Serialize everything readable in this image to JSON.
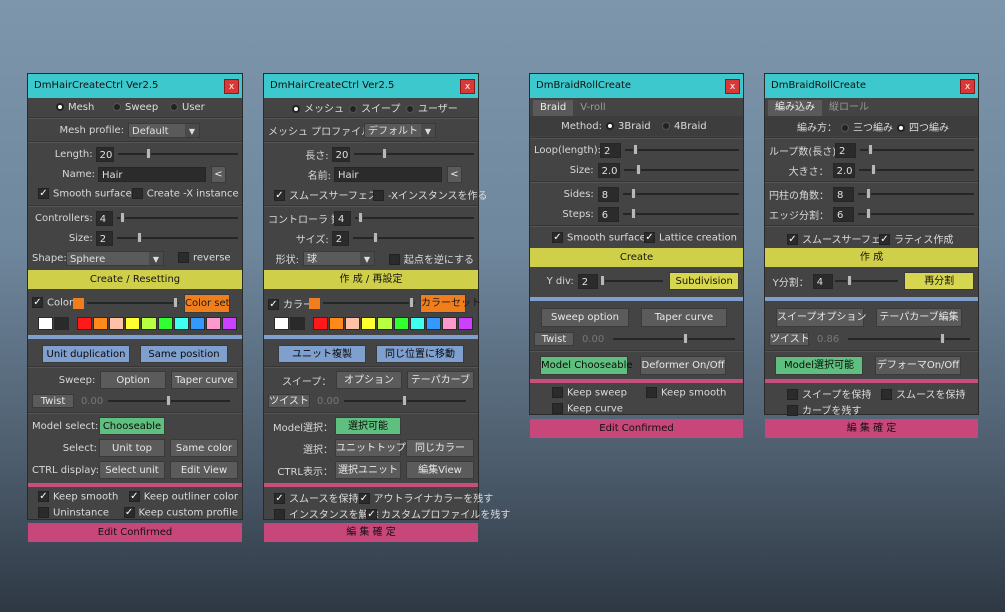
{
  "w1": {
    "title": "DmHairCreateCtrl Ver2.5",
    "close": "x",
    "modes": [
      "Mesh",
      "Sweep",
      "User"
    ],
    "profile_label": "Mesh profile:",
    "profile_value": "Default",
    "length_label": "Length:",
    "length_value": "20",
    "name_label": "Name:",
    "name_value": "Hair",
    "name_btn": "<",
    "smooth_surface": "Smooth surface",
    "create_x": "Create -X instance",
    "controllers_label": "Controllers:",
    "controllers_value": "4",
    "size_label": "Size:",
    "size_value": "2",
    "shape_label": "Shape:",
    "shape_value": "Sphere",
    "reverse": "reverse",
    "create_btn": "Create / Resetting",
    "color_label": "Color",
    "color_set": "Color set",
    "unit_dup": "Unit duplication",
    "same_pos": "Same position",
    "sweep_label": "Sweep:",
    "option_btn": "Option",
    "taper_btn": "Taper curve",
    "twist_label": "Twist",
    "twist_value": "0.00",
    "model_select_label": "Model select:",
    "chooseable": "Chooseable",
    "select_label": "Select:",
    "unit_top": "Unit top",
    "same_color": "Same color",
    "ctrl_label": "CTRL display:",
    "select_unit": "Select unit",
    "edit_view": "Edit View",
    "keep_smooth": "Keep smooth",
    "keep_outliner": "Keep outliner color",
    "uninstance": "Uninstance",
    "keep_custom": "Keep custom profile",
    "edit_confirmed": "Edit Confirmed"
  },
  "w2": {
    "title": "DmHairCreateCtrl Ver2.5",
    "close": "x",
    "modes": [
      "メッシュ",
      "スイープ",
      "ユーザー"
    ],
    "profile_label": "メッシュ プロファイル：",
    "profile_value": "デフォルト",
    "length_label": "長さ:",
    "length_value": "20",
    "name_label": "名前:",
    "name_value": "Hair",
    "name_btn": "<",
    "smooth_surface": "スムースサーフェス",
    "create_x": "-Xインスタンスを作る",
    "controllers_label": "コントローラ 数:",
    "controllers_value": "4",
    "size_label": "サイズ:",
    "size_value": "2",
    "shape_label": "形状:",
    "shape_value": "球",
    "reverse": "起点を逆にする",
    "create_btn": "作 成 / 再設定",
    "color_label": "カラー",
    "color_set": "カラーセット",
    "unit_dup": "ユニット複製",
    "same_pos": "同じ位置に移動",
    "sweep_label": "スイープ：",
    "option_btn": "オプション",
    "taper_btn": "テーパカーブ",
    "twist_label": "ツイスト",
    "twist_value": "0.00",
    "model_select_label": "Model選択：",
    "chooseable": "選択可能",
    "select_label": "選択：",
    "unit_top": "ユニットトップ",
    "same_color": "同じカラー",
    "ctrl_label": "CTRL表示：",
    "select_unit": "選択ユニット",
    "edit_view": "編集View",
    "keep_smooth": "スムースを保持",
    "keep_outliner": "アウトライナカラーを残す",
    "uninstance": "インスタンスを解除",
    "keep_custom": "カスタムプロファイルを残す",
    "edit_confirmed": "編 集 確 定"
  },
  "w3": {
    "title": "DmBraidRollCreate",
    "close": "x",
    "tabs": [
      "Braid",
      "V-roll"
    ],
    "method_label": "Method:",
    "method_opts": [
      "3Braid",
      "4Braid"
    ],
    "loop_label": "Loop(length):",
    "loop_value": "2",
    "size_label": "Size:",
    "size_value": "2.0",
    "sides_label": "Sides:",
    "sides_value": "8",
    "steps_label": "Steps:",
    "steps_value": "6",
    "smooth_surface": "Smooth surface",
    "lattice": "Lattice creation",
    "create_btn": "Create",
    "ydiv_label": "Y div:",
    "ydiv_value": "2",
    "subdiv_btn": "Subdivision",
    "sweep_opt": "Sweep option",
    "taper_btn": "Taper curve",
    "twist_label": "Twist",
    "twist_value": "0.00",
    "model_choose": "Model Chooseable",
    "deformer": "Deformer On/Off",
    "keep_sweep": "Keep sweep",
    "keep_smooth": "Keep smooth",
    "keep_curve": "Keep curve",
    "edit_confirmed": "Edit Confirmed"
  },
  "w4": {
    "title": "DmBraidRollCreate",
    "close": "x",
    "tabs": [
      "編み込み",
      "縦ロール"
    ],
    "method_label": "編み方：",
    "method_opts": [
      "三つ編み",
      "四つ編み"
    ],
    "loop_label": "ループ数(長さ)：",
    "loop_value": "2",
    "size_label": "大きさ：",
    "size_value": "2.0",
    "sides_label": "円柱の角数：",
    "sides_value": "8",
    "steps_label": "エッジ分割：",
    "steps_value": "6",
    "smooth_surface": "スムースサーフェス",
    "lattice": "ラティス作成",
    "create_btn": "作 成",
    "ydiv_label": "Y分割：",
    "ydiv_value": "4",
    "subdiv_btn": "再分割",
    "sweep_opt": "スイープオプション",
    "taper_btn": "テーパカーブ編集",
    "twist_label": "ツイスト",
    "twist_value": "0.86",
    "model_choose": "Model選択可能",
    "deformer": "デフォーマOn/Off",
    "keep_sweep": "スイープを保持",
    "keep_smooth": "スムースを保持",
    "keep_curve": "カーブを残す",
    "edit_confirmed": "編 集 確 定"
  },
  "colors": {
    "accent_title": "#3cc8cc",
    "orange": "#f07e1c",
    "yellow": "#cfcf4a",
    "pink": "#c8477a",
    "blue": "#7f9fcf",
    "green": "#5fbf7f",
    "close": "#d83838"
  },
  "swatches": [
    "#ffffff",
    "#2a2a2a",
    "#ff1a1a",
    "#ff8a1a",
    "#ffc0a8",
    "#ffff30",
    "#b8ff40",
    "#30ff30",
    "#40ffee",
    "#3399ff",
    "#ff99cc",
    "#cc40ff"
  ]
}
